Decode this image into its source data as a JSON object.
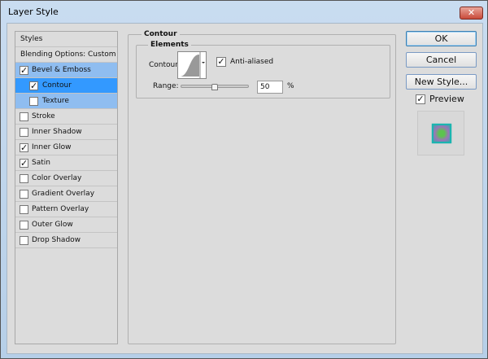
{
  "window": {
    "title": "Layer Style",
    "close": "✕"
  },
  "sidebar": {
    "items": [
      {
        "label": "Styles"
      },
      {
        "label": "Blending Options: Custom"
      },
      {
        "label": "Bevel & Emboss",
        "checked": true
      },
      {
        "label": "Contour",
        "checked": true
      },
      {
        "label": "Texture",
        "checked": false
      },
      {
        "label": "Stroke",
        "checked": false
      },
      {
        "label": "Inner Shadow",
        "checked": false
      },
      {
        "label": "Inner Glow",
        "checked": true
      },
      {
        "label": "Satin",
        "checked": true
      },
      {
        "label": "Color Overlay",
        "checked": false
      },
      {
        "label": "Gradient Overlay",
        "checked": false
      },
      {
        "label": "Pattern Overlay",
        "checked": false
      },
      {
        "label": "Outer Glow",
        "checked": false
      },
      {
        "label": "Drop Shadow",
        "checked": false
      }
    ]
  },
  "main": {
    "group_title": "Contour",
    "elements_title": "Elements",
    "contour_label": "Contour:",
    "anti_aliased_label": "Anti-aliased",
    "anti_aliased": true,
    "range_label": "Range:",
    "range_value": "50",
    "range_unit": "%",
    "range_percent": 50
  },
  "buttons": {
    "ok": "OK",
    "cancel": "Cancel",
    "new_style": "New Style..."
  },
  "preview": {
    "label": "Preview",
    "checked": true
  },
  "check": "✓"
}
